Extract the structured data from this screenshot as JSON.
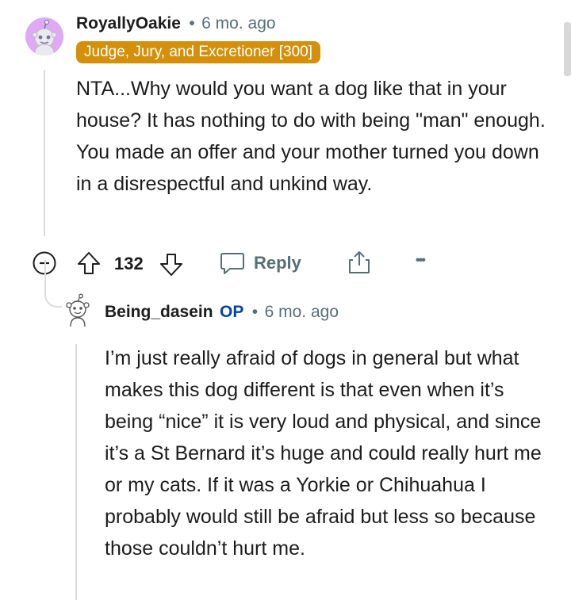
{
  "comment": {
    "author": "RoyallyOakie",
    "separator": "•",
    "age": "6 mo. ago",
    "flair": "Judge, Jury, and Excretioner [300]",
    "body": "NTA...Why would you want a dog like that in your house? It has nothing to do with being \"man\" enough. You made an offer and your mother turned you down in a disrespectful and unkind way.",
    "votes": "132",
    "reply_label": "Reply",
    "more": "•••"
  },
  "reply": {
    "author": "Being_dasein",
    "op_badge": "OP",
    "separator": "•",
    "age": "6 mo. ago",
    "body": "I’m just really afraid of dogs in general but what makes this dog different is that even when it’s being “nice” it is very loud and physical, and since it’s a St Bernard it’s huge and could really hurt me or my cats. If it was a Yorkie or Chihuahua I probably would still be afraid but less so because those couldn’t hurt me."
  },
  "colors": {
    "flair_bg": "#d4900b",
    "op_badge": "#0a449b",
    "meta_gray": "#576f76",
    "avatar_bg": "#dfa9f3"
  },
  "icons": [
    "snoo-avatar-icon",
    "collapse-icon",
    "upvote-icon",
    "downvote-icon",
    "comment-bubble-icon",
    "share-icon",
    "more-options-icon",
    "snoo-avatar-outline-icon"
  ]
}
